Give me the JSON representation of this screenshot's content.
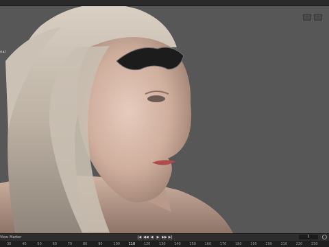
{
  "viewport": {
    "label_fragment": "rial"
  },
  "timeline": {
    "menus": [
      "View",
      "Marker"
    ],
    "transport_buttons": [
      "|◀",
      "◀◀",
      "◀",
      "▶",
      "▶▶",
      "▶|"
    ],
    "current_frame": "1",
    "ruler_ticks": [
      "30",
      "40",
      "50",
      "60",
      "70",
      "80",
      "90",
      "100",
      "110",
      "120",
      "130",
      "140",
      "150",
      "160",
      "170",
      "180",
      "190",
      "200",
      "210",
      "220",
      "230"
    ],
    "current_tick": "110"
  },
  "colors": {
    "viewport_bg": "#575757",
    "timeline_bg": "#232323",
    "accent": "#4772b3"
  }
}
